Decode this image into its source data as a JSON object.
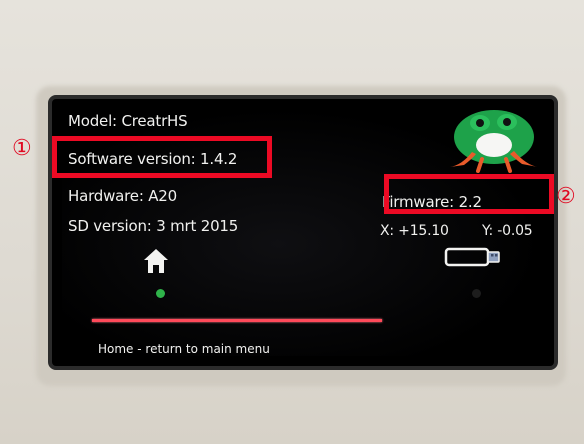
{
  "screen": {
    "model": "Model: CreatrHS",
    "software_version": "Software version: 1.4.2",
    "hardware": "Hardware: A20",
    "sd_version": "SD version: 3 mrt 2015",
    "firmware": "Firmware: 2.2",
    "x_coord": "X: +15.10",
    "y_coord": "Y: -0.05",
    "footer": "Home - return to main menu"
  },
  "annotations": {
    "marker_1": "①",
    "marker_2": "②"
  },
  "colors": {
    "annotation": "#ec0a24",
    "progress": "#ff4a5a",
    "status_active": "#2fb34a"
  },
  "icons": [
    "frog-logo-icon",
    "home-icon",
    "usb-drive-icon"
  ]
}
